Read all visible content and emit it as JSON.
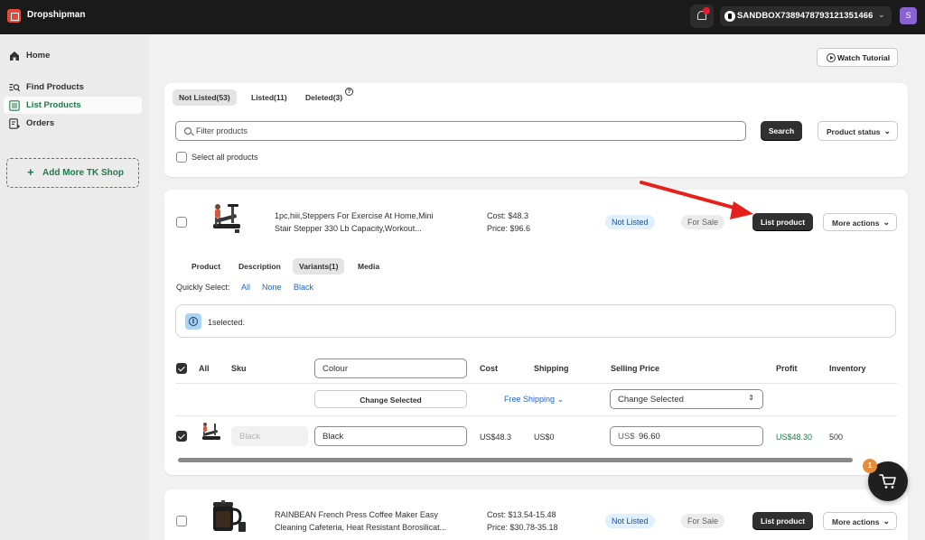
{
  "app": {
    "title": "Dropshipman",
    "notification_count": "1",
    "store_name": "SANDBOX7389478793121351466",
    "avatar_initial": "S"
  },
  "sidebar": {
    "items": [
      {
        "label": "Home",
        "icon": "home-icon"
      },
      {
        "label": "Find Products",
        "icon": "find-products-icon"
      },
      {
        "label": "List Products",
        "icon": "list-icon"
      },
      {
        "label": "Orders",
        "icon": "orders-icon"
      }
    ],
    "add_shop_label": "Add More TK Shop"
  },
  "header": {
    "watch_tutorial_label": "Watch Tutorial"
  },
  "filters": {
    "tabs": [
      {
        "label": "Not Listed(53)"
      },
      {
        "label": "Listed(11)"
      },
      {
        "label": "Deleted(3)"
      }
    ],
    "search_placeholder": "Filter products",
    "search_button": "Search",
    "status_select": "Product status",
    "select_all": "Select all products"
  },
  "products": [
    {
      "title_line1": "1pc,hiii,Steppers For Exercise At Home,Mini",
      "title_line2": "Stair Stepper 330 Lb Capacity,Workout...",
      "cost": "Cost: $48.3",
      "price": "Price: $96.6",
      "status": "Not Listed",
      "sale_status": "For Sale",
      "list_button": "List product",
      "more_actions": "More actions",
      "detail_tabs": [
        {
          "label": "Product"
        },
        {
          "label": "Description"
        },
        {
          "label": "Variants(1)"
        },
        {
          "label": "Media"
        }
      ],
      "quick_select_label": "Quickly Select:",
      "quick_select_options": [
        "All",
        "None",
        "Black"
      ],
      "selected_info": "1selected.",
      "variant_table": {
        "headers": {
          "all": "All",
          "sku": "Sku",
          "colour": "Colour",
          "cost": "Cost",
          "shipping": "Shipping",
          "selling_price": "Selling Price",
          "profit": "Profit",
          "inventory": "Inventory"
        },
        "change_selected": "Change Selected",
        "free_shipping": "Free Shipping",
        "price_change_selected": "Change Selected",
        "rows": [
          {
            "sku_placeholder": "Black",
            "colour": "Black",
            "cost": "US$48.3",
            "shipping": "US$0",
            "price_prefix": "US$",
            "price": "96.60",
            "profit": "US$48.30",
            "inventory": "500"
          }
        ]
      }
    },
    {
      "title_line1": "RAINBEAN French Press Coffee Maker Easy",
      "title_line2": "Cleaning Cafeteria, Heat Resistant Borosilicat...",
      "cost": "Cost: $13.54-15.48",
      "price": "Price: $30.78-35.18",
      "status": "Not Listed",
      "sale_status": "For Sale",
      "list_button": "List product",
      "more_actions": "More actions"
    }
  ],
  "cart": {
    "count": "1"
  },
  "colors": {
    "brand": "#e8483a",
    "accent_green": "#1e7a4a",
    "arrow": "#e5201b",
    "link": "#2463c7"
  }
}
